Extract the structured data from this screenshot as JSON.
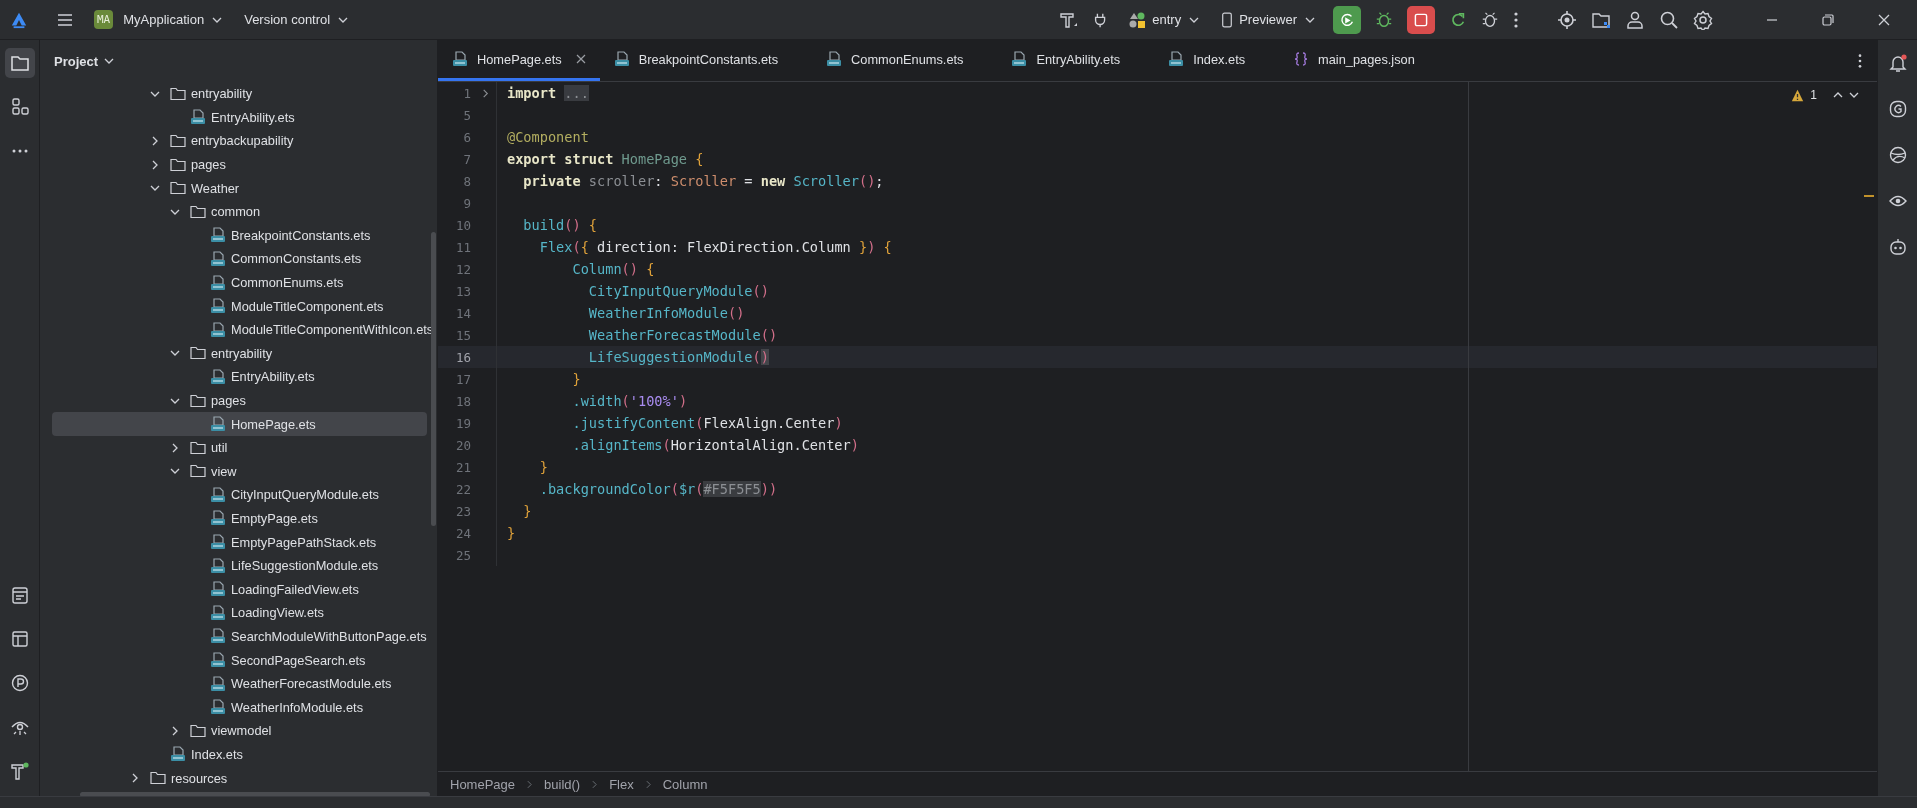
{
  "top_bar": {
    "project_badge": "MA",
    "project_name": "MyApplication",
    "version_control": "Version control",
    "run_target": "entry",
    "device": "Previewer"
  },
  "project_panel": {
    "title": "Project",
    "tree": [
      {
        "label": "entryability",
        "kind": "folder",
        "expanded": true,
        "selected": false,
        "children": [
          {
            "label": "EntryAbility.ets",
            "kind": "file",
            "selected": false
          }
        ]
      },
      {
        "label": "entrybackupability",
        "kind": "folder",
        "expanded": false,
        "selected": false
      },
      {
        "label": "pages",
        "kind": "folder",
        "expanded": false,
        "selected": false
      },
      {
        "label": "Weather",
        "kind": "folder",
        "expanded": true,
        "selected": false,
        "children": [
          {
            "label": "common",
            "kind": "folder",
            "expanded": true,
            "selected": false,
            "children": [
              {
                "label": "BreakpointConstants.ets",
                "kind": "file",
                "selected": false
              },
              {
                "label": "CommonConstants.ets",
                "kind": "file",
                "selected": false
              },
              {
                "label": "CommonEnums.ets",
                "kind": "file",
                "selected": false
              },
              {
                "label": "ModuleTitleComponent.ets",
                "kind": "file",
                "selected": false
              },
              {
                "label": "ModuleTitleComponentWithIcon.ets",
                "kind": "file",
                "selected": false
              }
            ]
          },
          {
            "label": "entryability",
            "kind": "folder",
            "expanded": true,
            "selected": false,
            "children": [
              {
                "label": "EntryAbility.ets",
                "kind": "file",
                "selected": false
              }
            ]
          },
          {
            "label": "pages",
            "kind": "folder",
            "expanded": true,
            "selected": false,
            "children": [
              {
                "label": "HomePage.ets",
                "kind": "file",
                "selected": true
              }
            ]
          },
          {
            "label": "util",
            "kind": "folder",
            "expanded": false,
            "selected": false
          },
          {
            "label": "view",
            "kind": "folder",
            "expanded": true,
            "selected": false,
            "children": [
              {
                "label": "CityInputQueryModule.ets",
                "kind": "file",
                "selected": false
              },
              {
                "label": "EmptyPage.ets",
                "kind": "file",
                "selected": false
              },
              {
                "label": "EmptyPagePathStack.ets",
                "kind": "file",
                "selected": false
              },
              {
                "label": "LifeSuggestionModule.ets",
                "kind": "file",
                "selected": false
              },
              {
                "label": "LoadingFailedView.ets",
                "kind": "file",
                "selected": false
              },
              {
                "label": "LoadingView.ets",
                "kind": "file",
                "selected": false
              },
              {
                "label": "SearchModuleWithButtonPage.ets",
                "kind": "file",
                "selected": false
              },
              {
                "label": "SecondPageSearch.ets",
                "kind": "file",
                "selected": false
              },
              {
                "label": "WeatherForecastModule.ets",
                "kind": "file",
                "selected": false
              },
              {
                "label": "WeatherInfoModule.ets",
                "kind": "file",
                "selected": false
              }
            ]
          },
          {
            "label": "viewmodel",
            "kind": "folder",
            "expanded": false,
            "selected": false
          }
        ]
      },
      {
        "label": "Index.ets",
        "kind": "file",
        "selected": false
      }
    ],
    "outer_tree": [
      {
        "label": "resources",
        "kind": "folder",
        "expanded": false,
        "selected": false
      }
    ]
  },
  "tabs": [
    {
      "label": "HomePage.ets",
      "kind": "ets",
      "selected": true
    },
    {
      "label": "BreakpointConstants.ets",
      "kind": "ets",
      "selected": false
    },
    {
      "label": "CommonEnums.ets",
      "kind": "ets",
      "selected": false
    },
    {
      "label": "EntryAbility.ets",
      "kind": "ets",
      "selected": false
    },
    {
      "label": "Index.ets",
      "kind": "ets",
      "selected": false
    },
    {
      "label": "main_pages.json",
      "kind": "json",
      "selected": false
    }
  ],
  "editor": {
    "warning_count": "1",
    "lines": [
      {
        "number": "1",
        "folded": true,
        "current": false,
        "tokens": [
          {
            "text": "import ",
            "kind": "kw"
          },
          {
            "text": "...",
            "kind": "fold"
          }
        ]
      },
      {
        "number": "5",
        "folded": false,
        "current": false
      },
      {
        "number": "6",
        "folded": false,
        "current": false,
        "tokens": [
          {
            "text": "@Component",
            "kind": "anno"
          }
        ]
      },
      {
        "number": "7",
        "folded": false,
        "current": false,
        "tokens": [
          {
            "text": "export struct ",
            "kind": "kw"
          },
          {
            "text": "HomePage",
            "kind": "cls"
          },
          {
            "text": " {",
            "kind": "brace"
          }
        ]
      },
      {
        "number": "8",
        "folded": false,
        "current": false,
        "tokens": [
          {
            "text": "  private ",
            "kind": "kw"
          },
          {
            "text": "scroller",
            "kind": "field"
          },
          {
            "text": ": ",
            "kind": "plain"
          },
          {
            "text": "Scroller",
            "kind": "type"
          },
          {
            "text": " = ",
            "kind": "plain"
          },
          {
            "text": "new ",
            "kind": "kw"
          },
          {
            "text": "Scroller",
            "kind": "fn"
          },
          {
            "text": "()",
            "kind": "paren"
          },
          {
            "text": ";",
            "kind": "plain"
          }
        ]
      },
      {
        "number": "9",
        "folded": false,
        "current": false
      },
      {
        "number": "10",
        "folded": false,
        "current": false,
        "tokens": [
          {
            "text": "  build",
            "kind": "fn"
          },
          {
            "text": "()",
            "kind": "paren"
          },
          {
            "text": " {",
            "kind": "brace"
          }
        ]
      },
      {
        "number": "11",
        "folded": false,
        "current": false,
        "tokens": [
          {
            "text": "    Flex",
            "kind": "fn"
          },
          {
            "text": "(",
            "kind": "paren"
          },
          {
            "text": "{",
            "kind": "brace"
          },
          {
            "text": " direction: FlexDirection.Column ",
            "kind": "plain"
          },
          {
            "text": "}",
            "kind": "brace"
          },
          {
            "text": ")",
            "kind": "paren"
          },
          {
            "text": " {",
            "kind": "brace"
          }
        ]
      },
      {
        "number": "12",
        "folded": false,
        "current": false,
        "tokens": [
          {
            "text": "        Column",
            "kind": "fn"
          },
          {
            "text": "()",
            "kind": "paren"
          },
          {
            "text": " {",
            "kind": "brace"
          }
        ]
      },
      {
        "number": "13",
        "folded": false,
        "current": false,
        "tokens": [
          {
            "text": "          CityInputQueryModule",
            "kind": "fn"
          },
          {
            "text": "()",
            "kind": "paren"
          }
        ]
      },
      {
        "number": "14",
        "folded": false,
        "current": false,
        "tokens": [
          {
            "text": "          WeatherInfoModule",
            "kind": "fn"
          },
          {
            "text": "()",
            "kind": "paren"
          }
        ]
      },
      {
        "number": "15",
        "folded": false,
        "current": false,
        "tokens": [
          {
            "text": "          WeatherForecastModule",
            "kind": "fn"
          },
          {
            "text": "()",
            "kind": "paren"
          }
        ]
      },
      {
        "number": "16",
        "folded": false,
        "current": true,
        "tokens": [
          {
            "text": "          LifeSuggestionModule",
            "kind": "fn"
          },
          {
            "text": "(",
            "kind": "paren"
          },
          {
            "text": ")",
            "kind": "match"
          }
        ]
      },
      {
        "number": "17",
        "folded": false,
        "current": false,
        "tokens": [
          {
            "text": "        }",
            "kind": "brace"
          }
        ]
      },
      {
        "number": "18",
        "folded": false,
        "current": false,
        "tokens": [
          {
            "text": "        .width",
            "kind": "fn"
          },
          {
            "text": "(",
            "kind": "paren"
          },
          {
            "text": "'100%'",
            "kind": "str"
          },
          {
            "text": ")",
            "kind": "paren"
          }
        ]
      },
      {
        "number": "19",
        "folded": false,
        "current": false,
        "tokens": [
          {
            "text": "        .justifyContent",
            "kind": "fn"
          },
          {
            "text": "(",
            "kind": "paren"
          },
          {
            "text": "FlexAlign.Center",
            "kind": "plain"
          },
          {
            "text": ")",
            "kind": "paren"
          }
        ]
      },
      {
        "number": "20",
        "folded": false,
        "current": false,
        "tokens": [
          {
            "text": "        .alignItems",
            "kind": "fn"
          },
          {
            "text": "(",
            "kind": "paren"
          },
          {
            "text": "HorizontalAlign.Center",
            "kind": "plain"
          },
          {
            "text": ")",
            "kind": "paren"
          }
        ]
      },
      {
        "number": "21",
        "folded": false,
        "current": false,
        "tokens": [
          {
            "text": "    }",
            "kind": "brace"
          }
        ]
      },
      {
        "number": "22",
        "folded": false,
        "current": false,
        "tokens": [
          {
            "text": "    .backgroundColor",
            "kind": "fn"
          },
          {
            "text": "(",
            "kind": "paren"
          },
          {
            "text": "$r",
            "kind": "fn"
          },
          {
            "text": "(",
            "kind": "paren"
          },
          {
            "text": "#F5F5F5",
            "kind": "hl"
          },
          {
            "text": "))",
            "kind": "paren"
          }
        ]
      },
      {
        "number": "23",
        "folded": false,
        "current": false,
        "tokens": [
          {
            "text": "  }",
            "kind": "brace"
          }
        ]
      },
      {
        "number": "24",
        "folded": false,
        "current": false,
        "tokens": [
          {
            "text": "}",
            "kind": "brace"
          }
        ]
      },
      {
        "number": "25",
        "folded": false,
        "current": false
      }
    ]
  },
  "breadcrumb": [
    "HomePage",
    "build()",
    "Flex",
    "Column"
  ]
}
